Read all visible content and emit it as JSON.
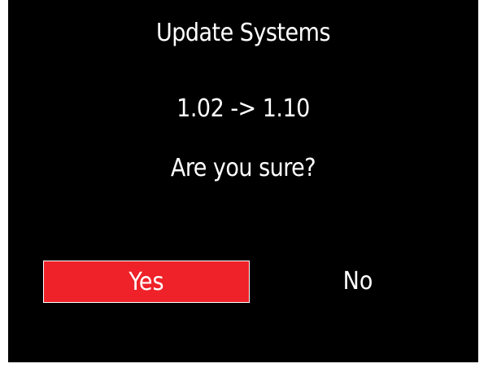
{
  "dialog": {
    "title": "Update Systems",
    "version_change": "1.02 -> 1.10",
    "question": "Are you sure?",
    "yes_label": "Yes",
    "no_label": "No",
    "selected_option": "Yes"
  },
  "colors": {
    "background": "#000000",
    "text": "#ffffff",
    "selected_button": "#ee2228"
  }
}
